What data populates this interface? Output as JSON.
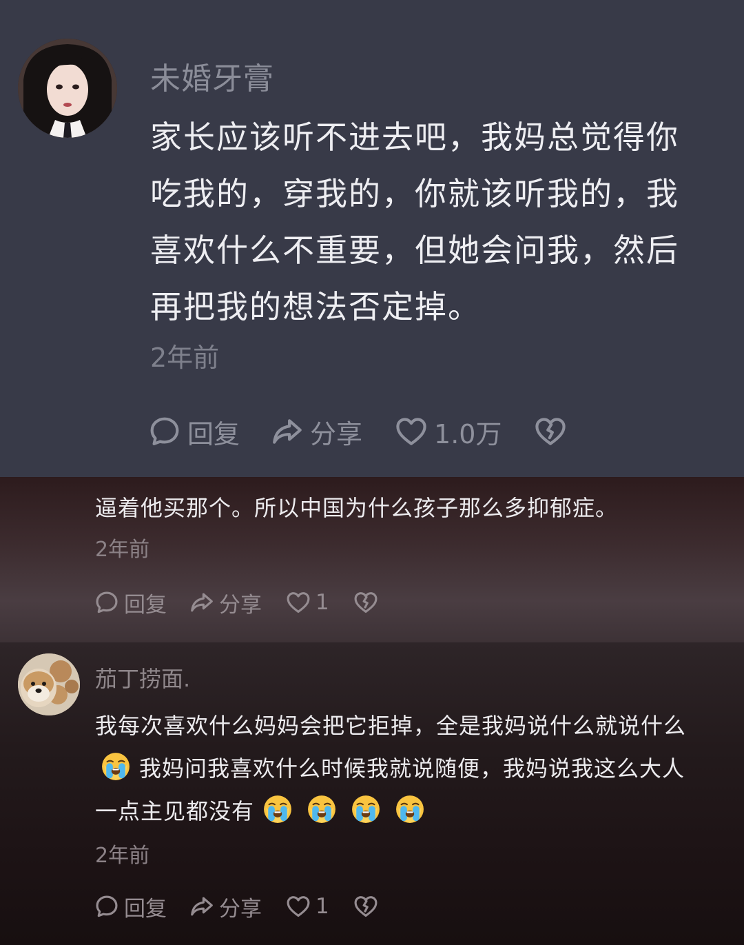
{
  "top_comment": {
    "username": "未婚牙膏",
    "lines": [
      "家长应该听不进去吧，我妈总觉得你",
      "吃我的，穿我的，你就该听我的，我",
      "喜欢什么不重要，但她会问我，然后",
      "再把我的想法否定掉。"
    ],
    "time": "2年前",
    "actions": {
      "reply_label": "回复",
      "share_label": "分享",
      "like_count": "1.0万"
    }
  },
  "reply_fragment": {
    "text": "逼着他买那个。所以中国为什么孩子那么多抑郁症。",
    "time": "2年前",
    "actions": {
      "reply_label": "回复",
      "share_label": "分享",
      "like_count": "1"
    }
  },
  "second_comment": {
    "username": "茄丁捞面.",
    "line1": "我每次喜欢什么妈妈会把它拒掉，全是我妈说什么就说什么",
    "line2_text": "我妈问我喜欢什么时候我就说随便，我妈说我这么大人",
    "line3_text": "一点主见都没有",
    "emoji_name": "loudly-crying-face",
    "time": "2年前",
    "actions": {
      "reply_label": "回复",
      "share_label": "分享",
      "like_count": "1"
    }
  },
  "colors": {
    "top_panel_bg": "#383a48",
    "text_primary": "#eeeef2",
    "text_secondary": "#8b8d99"
  },
  "icons": [
    "comment-icon",
    "share-icon",
    "heart-icon",
    "broken-heart-icon"
  ]
}
